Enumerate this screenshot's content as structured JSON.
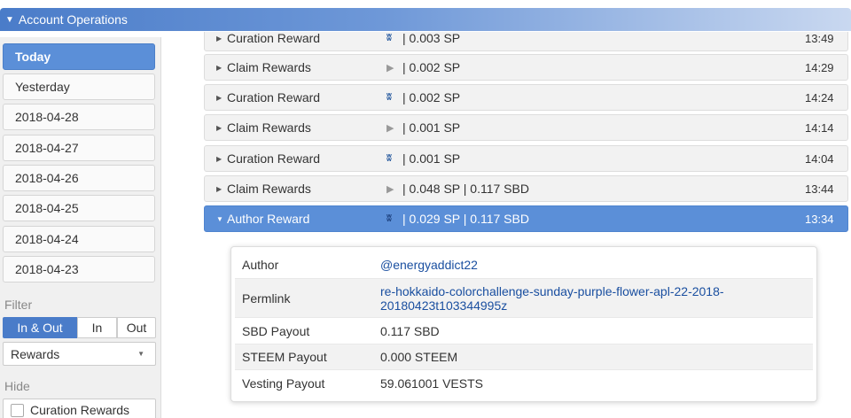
{
  "header": {
    "title": "Account Operations"
  },
  "sidebar": {
    "dates": [
      "Today",
      "Yesterday",
      "2018-04-28",
      "2018-04-27",
      "2018-04-26",
      "2018-04-25",
      "2018-04-24",
      "2018-04-23"
    ],
    "active_date": "Today",
    "filter_label": "Filter",
    "filter_options": [
      "In & Out",
      "In",
      "Out"
    ],
    "filter_selected": "In & Out",
    "type_select": "Rewards",
    "hide_label": "Hide",
    "hide_checkbox": "Curation Rewards"
  },
  "operations": [
    {
      "name": "Curation Reward",
      "icon": "steem-icon",
      "amount": "| 0.003 SP",
      "time": "13:49"
    },
    {
      "name": "Claim Rewards",
      "icon": "play-icon",
      "amount": "| 0.002 SP",
      "time": "14:29"
    },
    {
      "name": "Curation Reward",
      "icon": "steem-icon",
      "amount": "| 0.002 SP",
      "time": "14:24"
    },
    {
      "name": "Claim Rewards",
      "icon": "play-icon",
      "amount": "| 0.001 SP",
      "time": "14:14"
    },
    {
      "name": "Curation Reward",
      "icon": "steem-icon",
      "amount": "| 0.001 SP",
      "time": "14:04"
    },
    {
      "name": "Claim Rewards",
      "icon": "play-icon",
      "amount": "| 0.048 SP | 0.117 SBD",
      "time": "13:44"
    },
    {
      "name": "Author Reward",
      "icon": "steem-icon",
      "amount": "| 0.029 SP | 0.117 SBD",
      "time": "13:34"
    }
  ],
  "detail": {
    "author_label": "Author",
    "author": "@energyaddict22",
    "permlink_label": "Permlink",
    "permlink_1": "re-hokkaido-colorchallenge-sunday-purple-flower-apl-22-2018-",
    "permlink_2": "20180423t103344995z",
    "sbd_label": "SBD Payout",
    "sbd": "0.117 SBD",
    "steem_label": "STEEM Payout",
    "steem": "0.000 STEEM",
    "vesting_label": "Vesting Payout",
    "vesting": "59.061001 VESTS"
  }
}
